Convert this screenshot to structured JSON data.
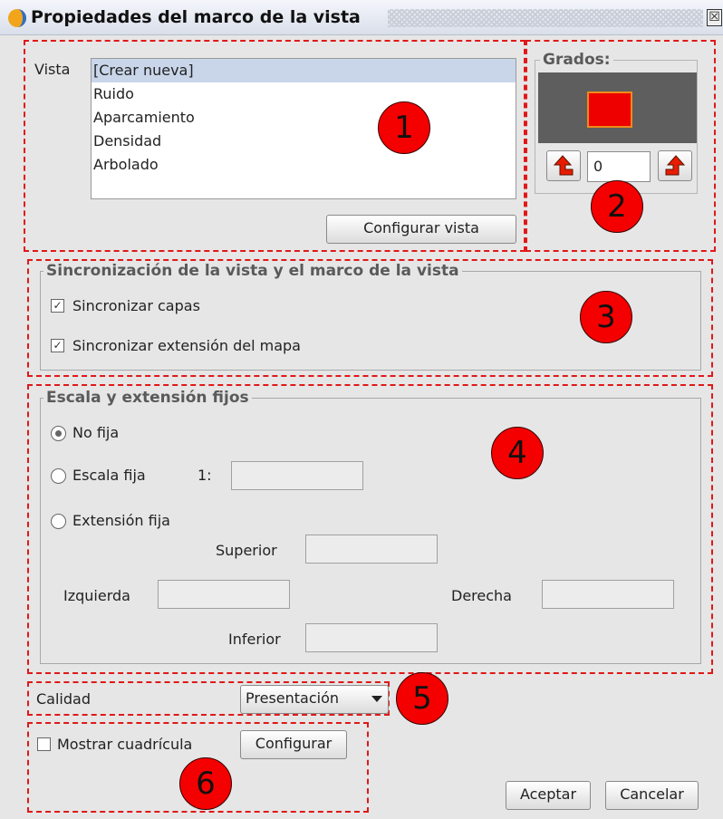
{
  "window": {
    "title": "Propiedades del marco de la vista",
    "close_glyph": "☒"
  },
  "vista": {
    "label": "Vista",
    "items": [
      "[Crear nueva]",
      "Ruido",
      "Aparcamiento",
      "Densidad",
      "Arbolado"
    ],
    "selected_index": 0,
    "configure_button": "Configurar vista"
  },
  "grados": {
    "legend": "Grados:",
    "value": "0",
    "preview_color": "#ee0000"
  },
  "sync": {
    "legend": "Sincronización de la vista y el marco de la vista",
    "layers": {
      "label": "Sincronizar capas",
      "checked": true
    },
    "extent": {
      "label": "Sincronizar extensión del mapa",
      "checked": true
    }
  },
  "scale": {
    "legend": "Escala y extensión fijos",
    "not_fixed": {
      "label": "No fija",
      "selected": true
    },
    "fixed_scale": {
      "label": "Escala fija",
      "prefix": "1:",
      "value": ""
    },
    "fixed_extent": {
      "label": "Extensión fija"
    },
    "top_label": "Superior",
    "left_label": "Izquierda",
    "right_label": "Derecha",
    "bottom_label": "Inferior"
  },
  "quality": {
    "label": "Calidad",
    "value": "Presentación"
  },
  "grid": {
    "label": "Mostrar cuadrícula",
    "checked": false,
    "configure_button": "Configurar"
  },
  "footer": {
    "ok": "Aceptar",
    "cancel": "Cancelar"
  },
  "markers": [
    "1",
    "2",
    "3",
    "4",
    "5",
    "6"
  ],
  "colors": {
    "highlight": "#e01818",
    "marker": "#f40000",
    "selection": "#c9d6ea",
    "arrow": "#e81c00"
  }
}
